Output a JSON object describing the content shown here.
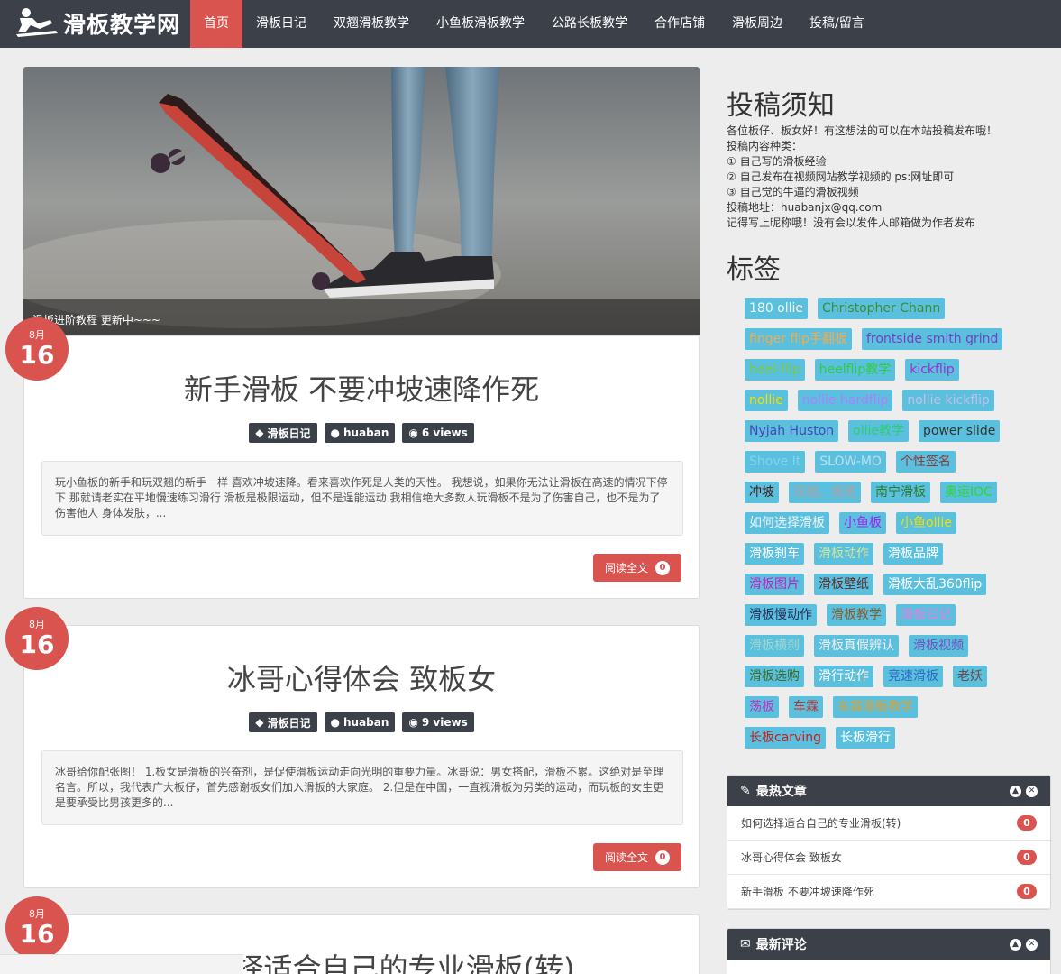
{
  "site": {
    "logo_text": "滑板教学网",
    "nav": [
      "首页",
      "滑板日记",
      "双翘滑板教学",
      "小鱼板滑板教学",
      "公路长板教学",
      "合作店铺",
      "滑板周边",
      "投稿/留言"
    ]
  },
  "hero": {
    "caption": "滑板进阶教程 更新中~~~"
  },
  "posts": [
    {
      "month": "8月",
      "day": "16",
      "title": "新手滑板 不要冲坡速降作死",
      "category": "滑板日记",
      "author": "huaban",
      "views": "6 views",
      "excerpt": "玩小鱼板的新手和玩双翘的新手一样 喜欢冲坡速降。看来喜欢作死是人类的天性。 我想说，如果你无法让滑板在高速的情况下停下 那就请老实在平地慢速练习滑行 滑板是极限运动，但不是逞能运动 我相信绝大多数人玩滑板不是为了伤害自己，也不是为了伤害他人 身体发肤，...",
      "read_label": "阅读全文",
      "read_count": "0"
    },
    {
      "month": "8月",
      "day": "16",
      "title": "冰哥心得体会 致板女",
      "category": "滑板日记",
      "author": "huaban",
      "views": "9 views",
      "excerpt": "冰哥给你配张图！ 1.板女是滑板的兴奋剂，是促使滑板运动走向光明的重要力量。冰哥说：男女搭配，滑板不累。这绝对是至理名言。所以，我代表广大板仔，首先感谢板女们加入滑板的大家庭。 2.但是在中国，一直视滑板为另类的运动，而玩板的女生更是要承受比男孩更多的...",
      "read_label": "阅读全文",
      "read_count": "0"
    },
    {
      "month": "8月",
      "day": "16",
      "title": "如何选择适合自己的专业滑板(转)"
    }
  ],
  "sidebar": {
    "notice_title": "投稿须知",
    "notice_lines": [
      "各位板仔、板女好！有这想法的可以在本站投稿发布哦！",
      "投稿内容种类：",
      "① 自己写的滑板经验",
      "② 自己发布在视频网站教学视频的 ps:网址即可",
      "③ 自己觉的牛逼的滑板视频",
      "投稿地址：huabanjx@qq.com",
      "记得写上昵称哦！没有会以发件人邮箱做为作者发布"
    ],
    "tags_title": "标签",
    "tags": [
      [
        {
          "t": "180 ollie",
          "c": "#f3f3f3"
        },
        {
          "t": "Christopher Chann",
          "c": "#3d8b3d"
        }
      ],
      [
        {
          "t": "finger flip手翻板",
          "c": "#f0ad4e"
        },
        {
          "t": "frontside smith grind",
          "c": "#6f42c1"
        }
      ],
      [
        {
          "t": "heel-flip",
          "c": "#7ac943"
        },
        {
          "t": "heelflip教学",
          "c": "#2ecc40"
        },
        {
          "t": "kickflip",
          "c": "#9b30d0"
        }
      ],
      [
        {
          "t": "nollie",
          "c": "#f1e000"
        },
        {
          "t": "nollie hardflip",
          "c": "#b07cff"
        },
        {
          "t": "nollie kickflip",
          "c": "#c0c0e8"
        }
      ],
      [
        {
          "t": "Nyjah Huston",
          "c": "#4646b4"
        },
        {
          "t": "ollie教学",
          "c": "#2ecc71"
        },
        {
          "t": "power slide",
          "c": "#333333"
        }
      ],
      [
        {
          "t": "Shove It",
          "c": "#7fd6ee"
        },
        {
          "t": "SLOW-MO",
          "c": "#b8e0f0"
        },
        {
          "t": "个性签名",
          "c": "#8b3a3a"
        }
      ],
      [
        {
          "t": "冲坡",
          "c": "#3a1a1a"
        },
        {
          "t": "双翘，板尾",
          "c": "#b0a0a0"
        },
        {
          "t": "南宁滑板",
          "c": "#2b7a2b"
        },
        {
          "t": "奥运IOC",
          "c": "#2ed62e"
        }
      ],
      [
        {
          "t": "如何选择滑板",
          "c": "#f0f0f0"
        },
        {
          "t": "小鱼板",
          "c": "#a020f0"
        },
        {
          "t": "小鱼ollie",
          "c": "#f1e000"
        }
      ],
      [
        {
          "t": "滑板刹车",
          "c": "#ffffff"
        },
        {
          "t": "滑板动作",
          "c": "#d0e8a0"
        },
        {
          "t": "滑板品牌",
          "c": "#ffffff"
        }
      ],
      [
        {
          "t": "滑板图片",
          "c": "#c020c0"
        },
        {
          "t": "滑板壁纸",
          "c": "#5a2a2a"
        },
        {
          "t": "滑板大乱360flip",
          "c": "#ffffff"
        }
      ],
      [
        {
          "t": "滑板慢动作",
          "c": "#2a2a5a"
        },
        {
          "t": "滑板教学",
          "c": "#8a5a2a"
        },
        {
          "t": "滑板日记",
          "c": "#e080e0"
        }
      ],
      [
        {
          "t": "滑板横刹",
          "c": "#a0d8d0"
        },
        {
          "t": "滑板真假辨认",
          "c": "#f0f0f0"
        },
        {
          "t": "滑板视频",
          "c": "#7050c0"
        }
      ],
      [
        {
          "t": "滑板选购",
          "c": "#3a6a2a"
        },
        {
          "t": "滑行动作",
          "c": "#ffffff"
        },
        {
          "t": "竞速滑板",
          "c": "#2a6ac0"
        },
        {
          "t": "老妖",
          "c": "#6a4a4a"
        }
      ],
      [
        {
          "t": "荡板",
          "c": "#c030c0"
        },
        {
          "t": "车霖",
          "c": "#c03030"
        },
        {
          "t": "车霖滑板教学",
          "c": "#e0a030"
        }
      ],
      [
        {
          "t": "长板carving",
          "c": "#c02020"
        },
        {
          "t": "长板滑行",
          "c": "#ffffff"
        }
      ]
    ],
    "hot": {
      "title": "最热文章",
      "items": [
        {
          "t": "如何选择适合自己的专业滑板(转)",
          "n": "0"
        },
        {
          "t": "冰哥心得体会 致板女",
          "n": "0"
        },
        {
          "t": "新手滑板 不要冲坡速降作死",
          "n": "0"
        }
      ]
    },
    "comments": {
      "title": "最新评论"
    }
  }
}
